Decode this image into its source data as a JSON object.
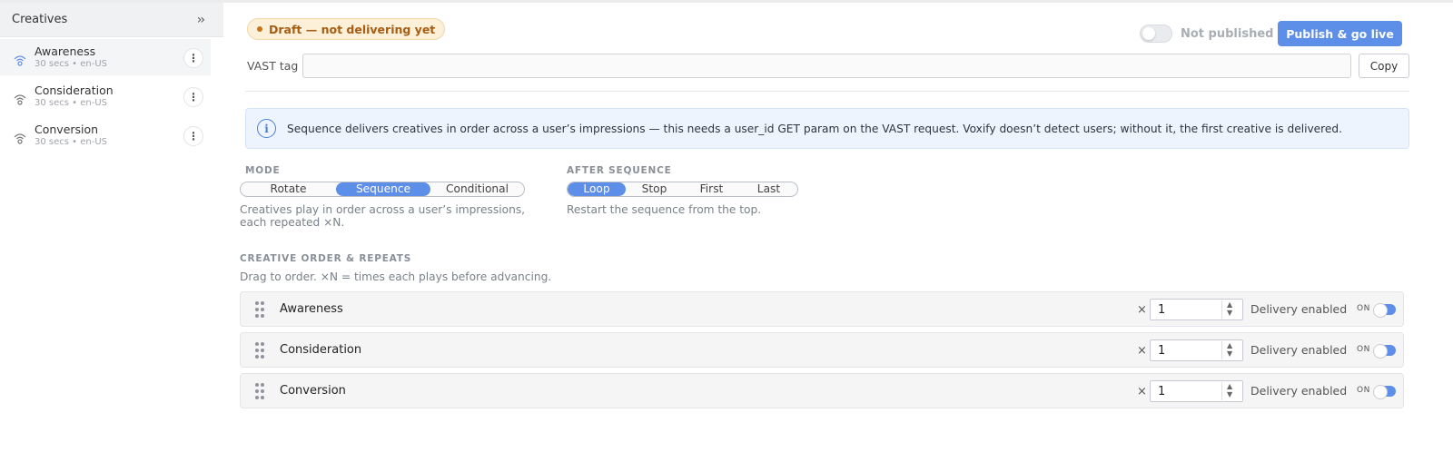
{
  "sidebar": {
    "title": "Creatives",
    "collapse_icon": "double-chevron-right-icon",
    "items": [
      {
        "name": "Awareness",
        "meta": "30 secs • en-US",
        "active": true
      },
      {
        "name": "Consideration",
        "meta": "30 secs • en-US",
        "active": false
      },
      {
        "name": "Conversion",
        "meta": "30 secs • en-US",
        "active": false
      }
    ]
  },
  "header": {
    "draft_badge": "Draft — not delivering yet",
    "publish_status": "Not published",
    "publish_button": "Publish & go live"
  },
  "vast": {
    "label": "VAST tag",
    "value": "",
    "copy_button": "Copy"
  },
  "info": {
    "text": "Sequence delivers creatives in order across a user’s impressions — this needs a user_id GET param on the VAST request. Voxify doesn’t detect users; without it, the first creative is delivered."
  },
  "mode": {
    "label": "MODE",
    "options": [
      "Rotate",
      "Sequence",
      "Conditional"
    ],
    "selected": "Sequence",
    "description_line1": "Creatives play in order across a user’s impressions,",
    "description_line2": "each repeated ×N."
  },
  "after_sequence": {
    "label": "AFTER SEQUENCE",
    "options": [
      "Loop",
      "Stop",
      "First",
      "Last"
    ],
    "selected": "Loop",
    "description": "Restart the sequence from the top."
  },
  "order": {
    "label": "CREATIVE ORDER & REPEATS",
    "hint": "Drag to order. ×N = times each plays before advancing.",
    "times_symbol": "×",
    "delivery_label": "Delivery enabled",
    "on_label": "ON",
    "rows": [
      {
        "name": "Awareness",
        "repeats": "1",
        "enabled": true
      },
      {
        "name": "Consideration",
        "repeats": "1",
        "enabled": true
      },
      {
        "name": "Conversion",
        "repeats": "1",
        "enabled": true
      }
    ]
  },
  "colors": {
    "accent": "#5d8ee8",
    "draft_bg": "#fdf0d8",
    "draft_text": "#a45d12",
    "info_bg": "#eef4fd"
  }
}
